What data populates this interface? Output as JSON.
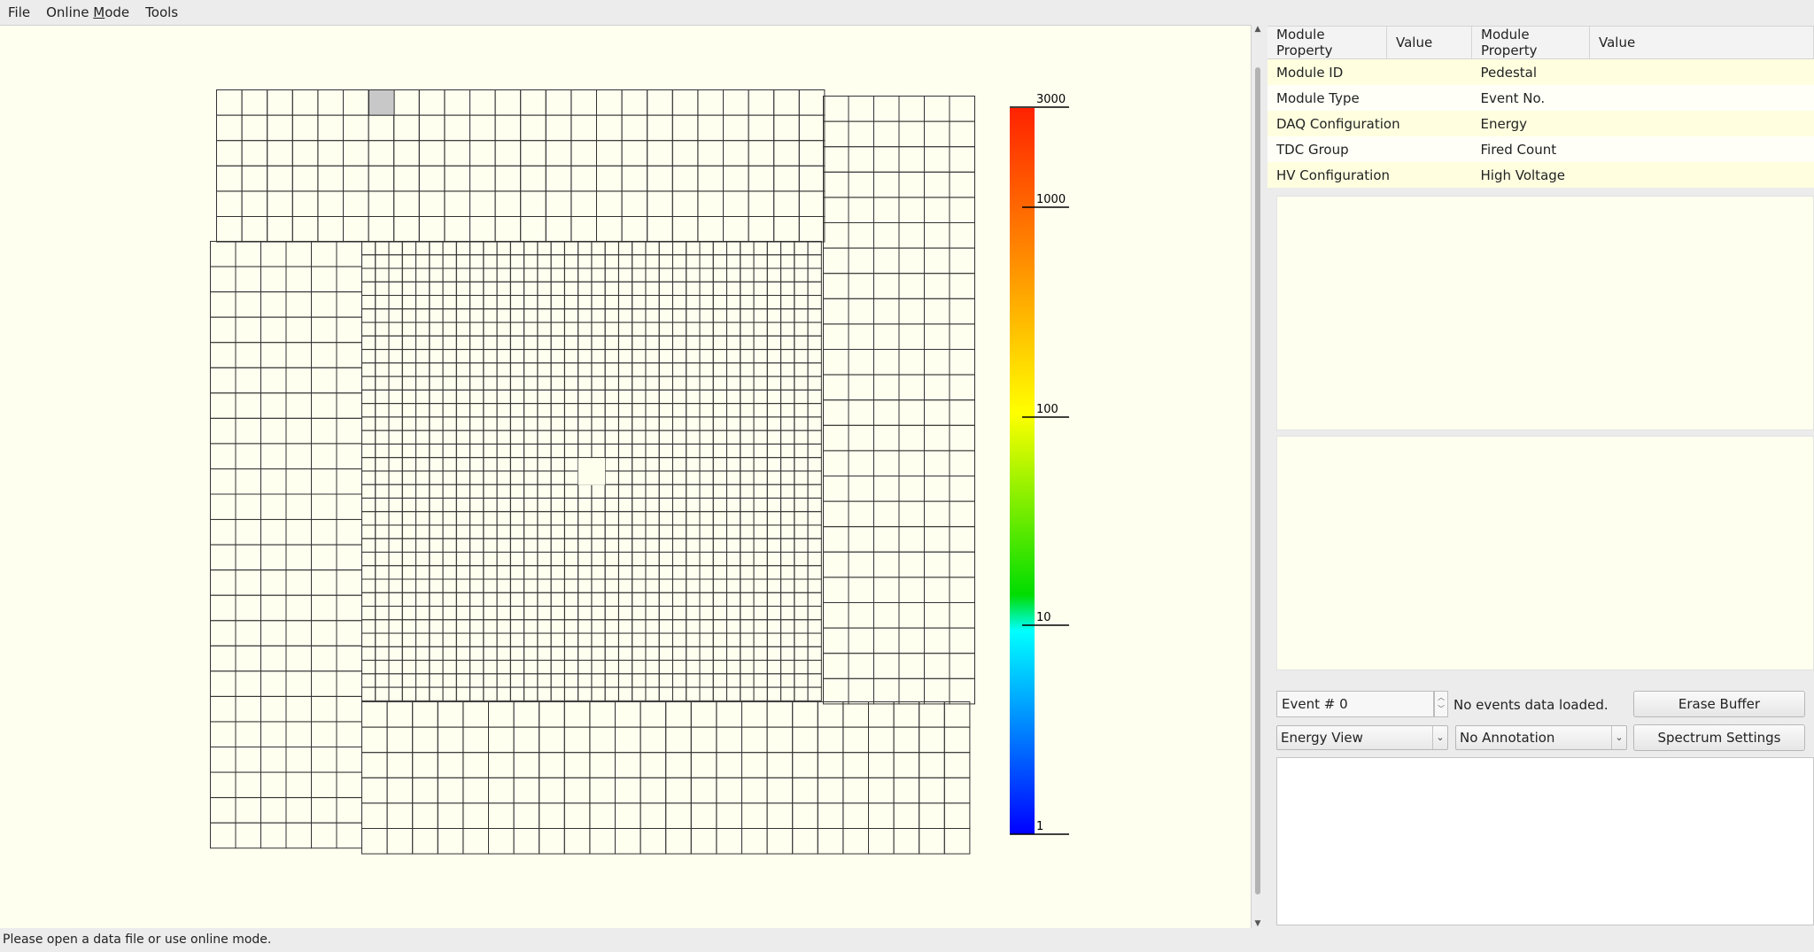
{
  "menu": {
    "file": "File",
    "online_mode_pre": "Online ",
    "online_mode_u": "M",
    "online_mode_post": "ode",
    "tools": "Tools"
  },
  "colorbar": {
    "labels": [
      "3000",
      "1000",
      "100",
      "10",
      "1"
    ],
    "colors": [
      "#ff2200",
      "#ff8800",
      "#ffff00",
      "#00dd00",
      "#00ffff",
      "#0000ff"
    ]
  },
  "calorimeter": {
    "cell_stroke": "#333333",
    "highlight_fill": "#c8c8c8",
    "empty_cell_fill": "#ffffee"
  },
  "prop_table": {
    "headers": [
      "Module Property",
      "Value",
      "Module Property",
      "Value"
    ],
    "rows": [
      {
        "left": "Module ID",
        "right": "Pedestal"
      },
      {
        "left": "Module Type",
        "right": "Event No."
      },
      {
        "left": "DAQ Configuration",
        "right": "Energy"
      },
      {
        "left": "TDC Group",
        "right": "Fired Count"
      },
      {
        "left": "HV Configuration",
        "right": "High Voltage"
      }
    ]
  },
  "controls": {
    "event_value": "Event # 0",
    "status_msg": "No events data loaded.",
    "erase_buffer": "Erase Buffer",
    "view_mode": "Energy View",
    "annotation": "No Annotation",
    "spectrum_settings": "Spectrum Settings"
  },
  "statusbar": "Please open a data file or use online mode."
}
